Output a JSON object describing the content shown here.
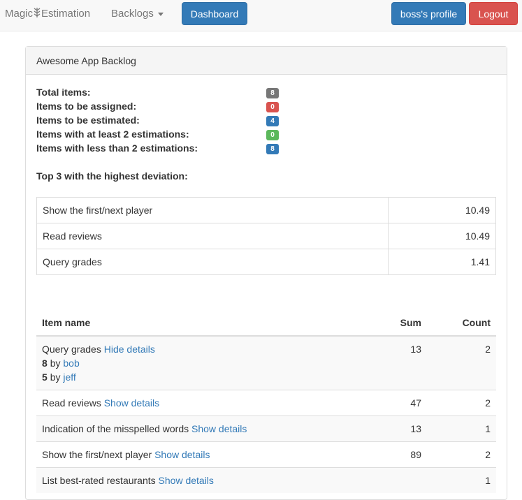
{
  "navbar": {
    "brand_left": "Magic",
    "brand_icon": "grain-icon",
    "brand_right": "Estimation",
    "backlogs_label": "Backlogs",
    "dashboard_label": "Dashboard",
    "profile_label": "boss's profile",
    "logout_label": "Logout"
  },
  "panel": {
    "title": "Awesome App Backlog"
  },
  "stats": [
    {
      "label": "Total items:",
      "value": "8",
      "color": "#777777"
    },
    {
      "label": "Items to be assigned:",
      "value": "0",
      "color": "#d9534f"
    },
    {
      "label": "Items to be estimated:",
      "value": "4",
      "color": "#337ab7"
    },
    {
      "label": "Items with at least 2 estimations:",
      "value": "0",
      "color": "#5cb85c"
    },
    {
      "label": "Items with less than 2 estimations:",
      "value": "8",
      "color": "#337ab7"
    }
  ],
  "top3": {
    "title": "Top 3 with the highest deviation:",
    "rows": [
      {
        "name": "Show the first/next player",
        "value": "10.49"
      },
      {
        "name": "Read reviews",
        "value": "10.49"
      },
      {
        "name": "Query grades",
        "value": "1.41"
      }
    ]
  },
  "items": {
    "headers": {
      "name": "Item name",
      "sum": "Sum",
      "count": "Count"
    },
    "rows": [
      {
        "name": "Query grades",
        "link": "Hide details",
        "sum": "13",
        "count": "2",
        "details": [
          {
            "value": "8",
            "by": "by",
            "user": "bob"
          },
          {
            "value": "5",
            "by": "by",
            "user": "jeff"
          }
        ]
      },
      {
        "name": "Read reviews",
        "link": "Show details",
        "sum": "47",
        "count": "2"
      },
      {
        "name": "Indication of the misspelled words",
        "link": "Show details",
        "sum": "13",
        "count": "1"
      },
      {
        "name": "Show the first/next player",
        "link": "Show details",
        "sum": "89",
        "count": "2"
      },
      {
        "name": "List best-rated restaurants",
        "link": "Show details",
        "sum": "",
        "count": "1"
      }
    ]
  }
}
